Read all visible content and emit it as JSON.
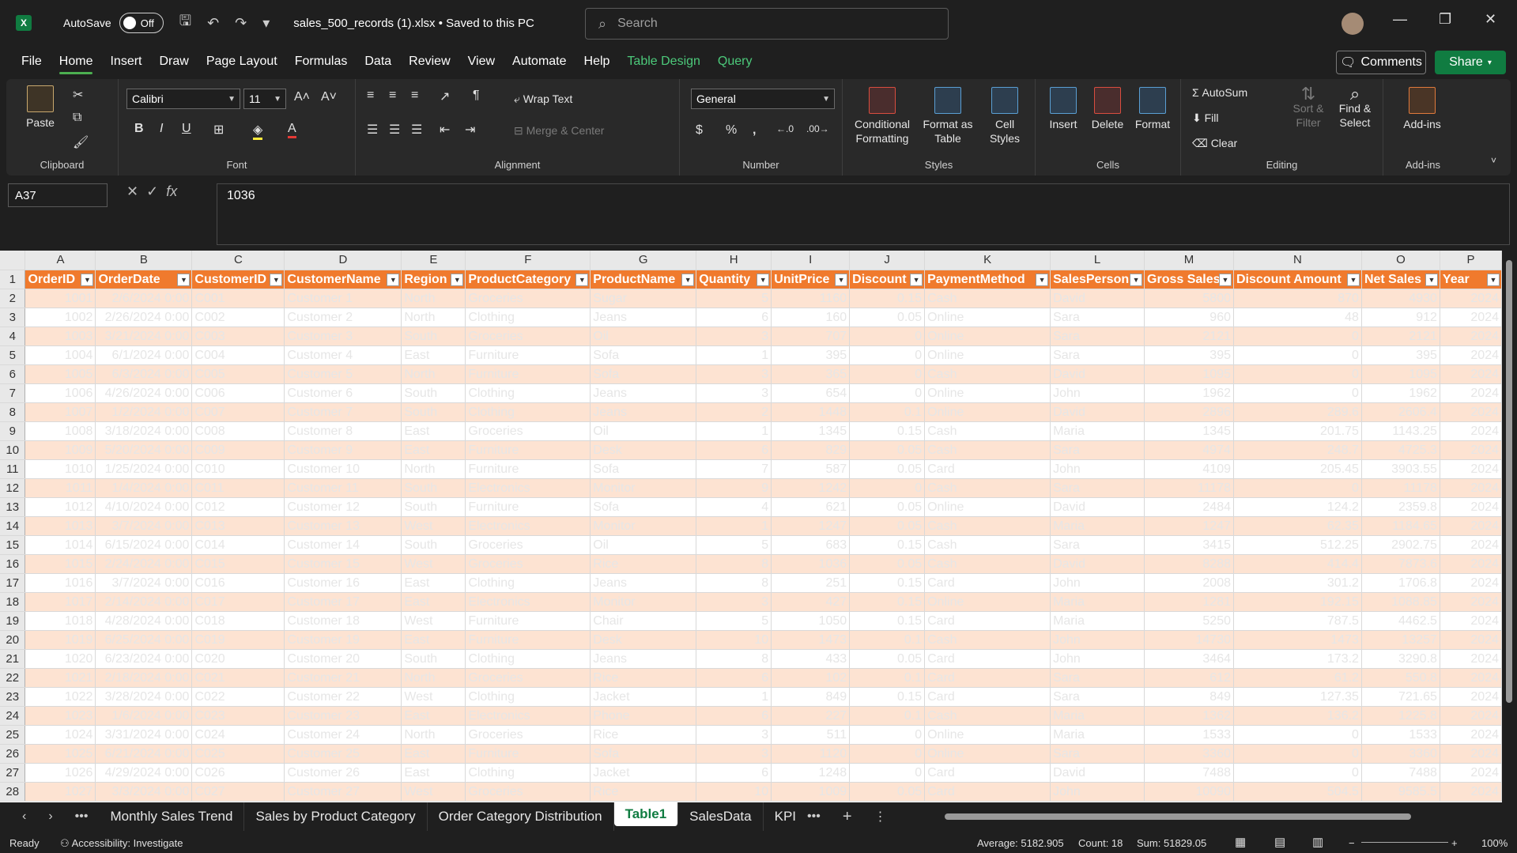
{
  "app": {
    "logo": "X",
    "autosave_label": "AutoSave",
    "autosave_state": "Off",
    "file_title": "sales_500_records (1).xlsx • Saved to this PC",
    "search_placeholder": "Search"
  },
  "menu": {
    "items": [
      "File",
      "Home",
      "Insert",
      "Draw",
      "Page Layout",
      "Formulas",
      "Data",
      "Review",
      "View",
      "Automate",
      "Help"
    ],
    "table_design": "Table Design",
    "query": "Query",
    "comments": "Comments",
    "share": "Share"
  },
  "ribbon": {
    "clipboard": {
      "label": "Clipboard",
      "paste": "Paste"
    },
    "font": {
      "label": "Font",
      "name": "Calibri",
      "size": "11"
    },
    "alignment": {
      "label": "Alignment",
      "wrap": "Wrap Text",
      "merge": "Merge & Center"
    },
    "number": {
      "label": "Number",
      "format": "General",
      "currency": "$",
      "percent": "%",
      "comma": ","
    },
    "styles": {
      "label": "Styles",
      "conditional": "Conditional",
      "conditional2": "Formatting",
      "format_as": "Format as",
      "format_as2": "Table",
      "cell": "Cell",
      "cell2": "Styles"
    },
    "cells": {
      "label": "Cells",
      "insert": "Insert",
      "delete": "Delete",
      "format": "Format"
    },
    "editing": {
      "label": "Editing",
      "autosum": "AutoSum",
      "fill": "Fill",
      "clear": "Clear",
      "sort": "Sort &",
      "sort2": "Filter",
      "find": "Find &",
      "find2": "Select"
    },
    "addins": {
      "label": "Add-ins",
      "addins": "Add-ins"
    }
  },
  "formula": {
    "name_box": "A37",
    "fx": "fx",
    "value": "1036"
  },
  "grid": {
    "columns": [
      "A",
      "B",
      "C",
      "D",
      "E",
      "F",
      "G",
      "H",
      "I",
      "J",
      "K",
      "L",
      "M",
      "N",
      "O",
      "P"
    ],
    "headers": [
      "OrderID",
      "OrderDate",
      "CustomerID",
      "CustomerName",
      "Region",
      "ProductCategory",
      "ProductName",
      "Quantity",
      "UnitPrice",
      "Discount",
      "PaymentMethod",
      "SalesPerson",
      "Gross Sales",
      "Discount Amount",
      "Net Sales",
      "Year"
    ],
    "rows": [
      [
        "1001",
        "2/6/2024 0:00",
        "C001",
        "Customer 1",
        "North",
        "Groceries",
        "Sugar",
        "5",
        "1160",
        "0.15",
        "Cash",
        "David",
        "5800",
        "870",
        "4930",
        "2024"
      ],
      [
        "1002",
        "2/26/2024 0:00",
        "C002",
        "Customer 2",
        "North",
        "Clothing",
        "Jeans",
        "6",
        "160",
        "0.05",
        "Online",
        "Sara",
        "960",
        "48",
        "912",
        "2024"
      ],
      [
        "1003",
        "3/21/2024 0:00",
        "C003",
        "Customer 3",
        "South",
        "Groceries",
        "Oil",
        "3",
        "707",
        "0",
        "Online",
        "Sara",
        "2121",
        "0",
        "2121",
        "2024"
      ],
      [
        "1004",
        "6/1/2024 0:00",
        "C004",
        "Customer 4",
        "East",
        "Furniture",
        "Sofa",
        "1",
        "395",
        "0",
        "Online",
        "Sara",
        "395",
        "0",
        "395",
        "2024"
      ],
      [
        "1005",
        "6/3/2024 0:00",
        "C005",
        "Customer 5",
        "North",
        "Furniture",
        "Sofa",
        "3",
        "365",
        "0",
        "Cash",
        "David",
        "1095",
        "0",
        "1095",
        "2024"
      ],
      [
        "1006",
        "4/26/2024 0:00",
        "C006",
        "Customer 6",
        "South",
        "Clothing",
        "Jeans",
        "3",
        "654",
        "0",
        "Online",
        "John",
        "1962",
        "0",
        "1962",
        "2024"
      ],
      [
        "1007",
        "1/2/2024 0:00",
        "C007",
        "Customer 7",
        "South",
        "Clothing",
        "Jeans",
        "2",
        "1448",
        "0.1",
        "Online",
        "David",
        "2896",
        "289.6",
        "2606.4",
        "2024"
      ],
      [
        "1008",
        "3/18/2024 0:00",
        "C008",
        "Customer 8",
        "East",
        "Groceries",
        "Oil",
        "1",
        "1345",
        "0.15",
        "Cash",
        "Maria",
        "1345",
        "201.75",
        "1143.25",
        "2024"
      ],
      [
        "1009",
        "5/20/2024 0:00",
        "C009",
        "Customer 9",
        "East",
        "Furniture",
        "Desk",
        "6",
        "829",
        "0.05",
        "Cash",
        "Sara",
        "4974",
        "248.7",
        "4725.3",
        "2024"
      ],
      [
        "1010",
        "1/25/2024 0:00",
        "C010",
        "Customer 10",
        "North",
        "Furniture",
        "Sofa",
        "7",
        "587",
        "0.05",
        "Card",
        "John",
        "4109",
        "205.45",
        "3903.55",
        "2024"
      ],
      [
        "1011",
        "1/4/2024 0:00",
        "C011",
        "Customer 11",
        "South",
        "Electronics",
        "Monitor",
        "9",
        "1242",
        "0",
        "Cash",
        "Sara",
        "11178",
        "0",
        "11178",
        "2024"
      ],
      [
        "1012",
        "4/10/2024 0:00",
        "C012",
        "Customer 12",
        "South",
        "Furniture",
        "Sofa",
        "4",
        "621",
        "0.05",
        "Online",
        "David",
        "2484",
        "124.2",
        "2359.8",
        "2024"
      ],
      [
        "1013",
        "3/7/2024 0:00",
        "C013",
        "Customer 13",
        "West",
        "Electronics",
        "Monitor",
        "1",
        "1247",
        "0.05",
        "Cash",
        "Maria",
        "1247",
        "62.35",
        "1184.65",
        "2024"
      ],
      [
        "1014",
        "6/15/2024 0:00",
        "C014",
        "Customer 14",
        "South",
        "Groceries",
        "Oil",
        "5",
        "683",
        "0.15",
        "Cash",
        "Sara",
        "3415",
        "512.25",
        "2902.75",
        "2024"
      ],
      [
        "1015",
        "2/24/2024 0:00",
        "C015",
        "Customer 15",
        "West",
        "Groceries",
        "Rice",
        "8",
        "1036",
        "0.05",
        "Cash",
        "David",
        "8288",
        "414.4",
        "7873.6",
        "2024"
      ],
      [
        "1016",
        "3/7/2024 0:00",
        "C016",
        "Customer 16",
        "East",
        "Clothing",
        "Jeans",
        "8",
        "251",
        "0.15",
        "Card",
        "John",
        "2008",
        "301.2",
        "1706.8",
        "2024"
      ],
      [
        "1017",
        "2/14/2024 0:00",
        "C017",
        "Customer 17",
        "East",
        "Electronics",
        "Monitor",
        "3",
        "427",
        "0.15",
        "Online",
        "Maria",
        "1281",
        "192.15",
        "1088.85",
        "2024"
      ],
      [
        "1018",
        "4/28/2024 0:00",
        "C018",
        "Customer 18",
        "West",
        "Furniture",
        "Chair",
        "5",
        "1050",
        "0.15",
        "Card",
        "Maria",
        "5250",
        "787.5",
        "4462.5",
        "2024"
      ],
      [
        "1019",
        "6/25/2024 0:00",
        "C019",
        "Customer 19",
        "East",
        "Furniture",
        "Desk",
        "10",
        "1473",
        "0.1",
        "Cash",
        "John",
        "14730",
        "1473",
        "13257",
        "2024"
      ],
      [
        "1020",
        "6/23/2024 0:00",
        "C020",
        "Customer 20",
        "South",
        "Clothing",
        "Jeans",
        "8",
        "433",
        "0.05",
        "Card",
        "John",
        "3464",
        "173.2",
        "3290.8",
        "2024"
      ],
      [
        "1021",
        "2/18/2024 0:00",
        "C021",
        "Customer 21",
        "North",
        "Groceries",
        "Rice",
        "6",
        "102",
        "0.1",
        "Card",
        "Sara",
        "612",
        "61.2",
        "550.8",
        "2024"
      ],
      [
        "1022",
        "3/28/2024 0:00",
        "C022",
        "Customer 22",
        "West",
        "Clothing",
        "Jacket",
        "1",
        "849",
        "0.15",
        "Card",
        "Sara",
        "849",
        "127.35",
        "721.65",
        "2024"
      ],
      [
        "1023",
        "1/6/2024 0:00",
        "C023",
        "Customer 23",
        "East",
        "Electronics",
        "Phone",
        "6",
        "227",
        "0.1",
        "Cash",
        "Maria",
        "1362",
        "136.2",
        "1225.8",
        "2024"
      ],
      [
        "1024",
        "3/31/2024 0:00",
        "C024",
        "Customer 24",
        "North",
        "Groceries",
        "Rice",
        "3",
        "511",
        "0",
        "Online",
        "Maria",
        "1533",
        "0",
        "1533",
        "2024"
      ],
      [
        "1025",
        "6/21/2024 0:00",
        "C025",
        "Customer 25",
        "East",
        "Furniture",
        "Sofa",
        "3",
        "1120",
        "0",
        "Online",
        "Sara",
        "3360",
        "0",
        "3360",
        "2024"
      ],
      [
        "1026",
        "4/29/2024 0:00",
        "C026",
        "Customer 26",
        "East",
        "Clothing",
        "Jacket",
        "6",
        "1248",
        "0",
        "Card",
        "David",
        "7488",
        "0",
        "7488",
        "2024"
      ],
      [
        "1027",
        "3/3/2024 0:00",
        "C027",
        "Customer 27",
        "West",
        "Groceries",
        "Rice",
        "10",
        "1009",
        "0.05",
        "Card",
        "John",
        "10090",
        "504.5",
        "9585.5",
        "2024"
      ]
    ]
  },
  "sheets": {
    "tabs": [
      "Monthly Sales Trend",
      "Sales by Product Category",
      "Order Category Distribution",
      "Table1",
      "SalesData",
      "KPI"
    ],
    "active": "Table1"
  },
  "status": {
    "ready": "Ready",
    "accessibility": "Accessibility: Investigate",
    "average": "Average: 5182.905",
    "count": "Count: 18",
    "sum": "Sum: 51829.05",
    "zoom": "100%"
  }
}
